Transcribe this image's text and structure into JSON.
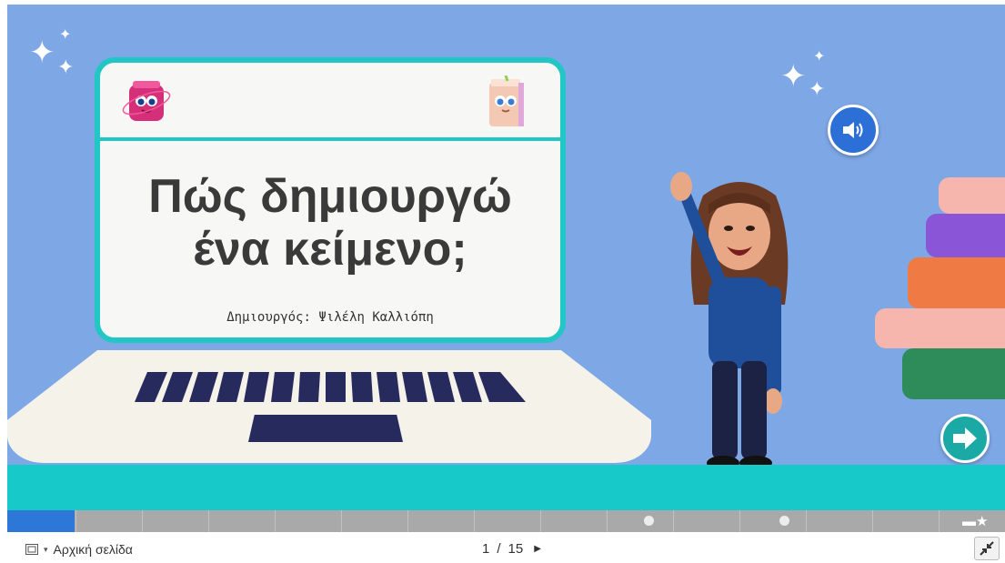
{
  "slide": {
    "title_line1": "Πώς δημιουργώ",
    "title_line2": "ένα κείμενο;",
    "author": "Δημιουργός: Ψιλέλη Καλλιόπη"
  },
  "icons": {
    "sound": "speaker-icon",
    "next": "arrow-right-icon",
    "home": "slides-icon",
    "pager_next": "triangle-right-icon",
    "fullscreen": "exit-fullscreen-icon"
  },
  "colors": {
    "background": "#7ea7e6",
    "floor": "#18c9c9",
    "accent": "#22c6c4",
    "progress": "#2d77d6",
    "button": "#2c6fd6"
  },
  "progress": {
    "fraction": 0.067
  },
  "footer": {
    "home_label": "Αρχική σελίδα",
    "current_page": "1",
    "separator": "/",
    "total_pages": "15"
  }
}
